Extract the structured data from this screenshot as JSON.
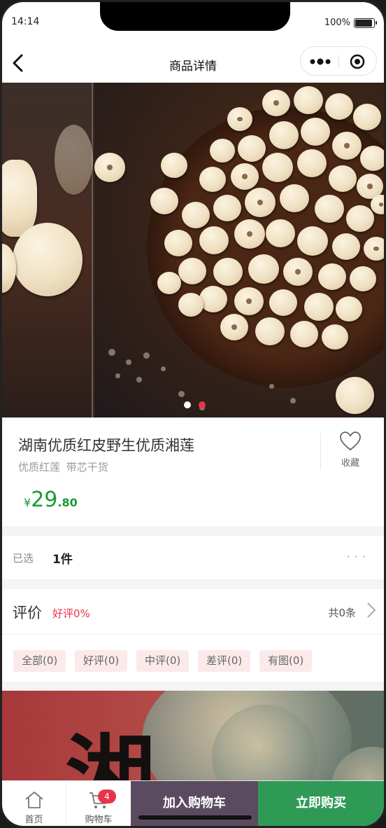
{
  "status_bar": {
    "time": "14:14",
    "battery": "100%"
  },
  "nav": {
    "title": "商品详情"
  },
  "gallery": {
    "slide_count": 2,
    "active_index": 1,
    "active_color": "#e8334a",
    "inactive_color": "#ffffff"
  },
  "product": {
    "title": "湖南优质红皮野生优质湘莲",
    "subtitle": "优质红莲 带芯干货",
    "favorite_label": "收藏",
    "price_currency": "¥",
    "price_integer": "29",
    "price_decimal": ".80",
    "price_color": "#1d9a33"
  },
  "selection": {
    "label": "已选",
    "value": "1件",
    "more": "···"
  },
  "reviews": {
    "title": "评价",
    "good_rate": "好评0%",
    "count": "共0条",
    "tags": [
      "全部(0)",
      "好评(0)",
      "中评(0)",
      "差评(0)",
      "有图(0)"
    ]
  },
  "banner": {
    "calligraphy": "湘"
  },
  "bottom_bar": {
    "home_label": "首页",
    "cart_label": "购物车",
    "cart_badge": "4",
    "add_to_cart": "加入购物车",
    "buy_now": "立即购买",
    "add_color": "#5b4b60",
    "buy_color": "#2f9a56"
  }
}
